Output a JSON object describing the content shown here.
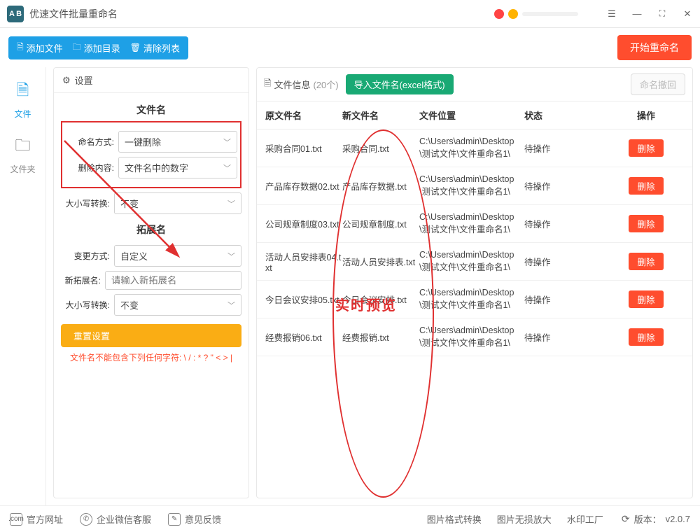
{
  "titlebar": {
    "title": "优速文件批量重命名",
    "logo_text": "A B"
  },
  "toolbar": {
    "add_file": "添加文件",
    "add_dir": "添加目录",
    "clear_list": "清除列表",
    "start": "开始重命名"
  },
  "leftrail": {
    "files": "文件",
    "folders": "文件夹"
  },
  "settings": {
    "header": "设置",
    "sec_filename": "文件名",
    "label_method": "命名方式:",
    "val_method": "一键删除",
    "label_delete": "删除内容:",
    "val_delete": "文件名中的数字",
    "label_case": "大小写转换:",
    "val_case": "不变",
    "sec_ext": "拓展名",
    "label_changeway": "变更方式:",
    "val_changeway": "自定义",
    "label_newext": "新拓展名:",
    "placeholder_newext": "请输入新拓展名",
    "label_case2": "大小写转换:",
    "val_case2": "不变",
    "reset": "重置设置",
    "warn": "文件名不能包含下列任何字符:  \\ / : * ? \" < > |"
  },
  "fileinfo": {
    "header_label": "文件信息",
    "header_count": "(20个)",
    "import": "导入文件名(excel格式)",
    "undo": "命名撤回",
    "cols": {
      "orig": "原文件名",
      "new": "新文件名",
      "path": "文件位置",
      "status": "状态",
      "op": "操作"
    },
    "preview_label": "实时预览",
    "del_label": "删除",
    "rows": [
      {
        "orig": "采购合同01.txt",
        "new": "采购合同.txt",
        "path": "C:\\Users\\admin\\Desktop\\测试文件\\文件重命名1\\",
        "status": "待操作"
      },
      {
        "orig": "产品库存数据02.txt",
        "new": "产品库存数据.txt",
        "path": "C:\\Users\\admin\\Desktop\\测试文件\\文件重命名1\\",
        "status": "待操作"
      },
      {
        "orig": "公司规章制度03.txt",
        "new": "公司规章制度.txt",
        "path": "C:\\Users\\admin\\Desktop\\测试文件\\文件重命名1\\",
        "status": "待操作"
      },
      {
        "orig": "活动人员安排表04.txt",
        "new": "活动人员安排表.txt",
        "path": "C:\\Users\\admin\\Desktop\\测试文件\\文件重命名1\\",
        "status": "待操作"
      },
      {
        "orig": "今日会议安排05.txt",
        "new": "今日会议安排.txt",
        "path": "C:\\Users\\admin\\Desktop\\测试文件\\文件重命名1\\",
        "status": "待操作"
      },
      {
        "orig": "经费报销06.txt",
        "new": "经费报销.txt",
        "path": "C:\\Users\\admin\\Desktop\\测试文件\\文件重命名1\\",
        "status": "待操作"
      }
    ]
  },
  "bottombar": {
    "site": "官方网址",
    "wecom": "企业微信客服",
    "feedback": "意见反馈",
    "img_convert": "图片格式转换",
    "img_zoom": "图片无损放大",
    "watermark": "水印工厂",
    "version_label": "版本：",
    "version": "v2.0.7"
  }
}
